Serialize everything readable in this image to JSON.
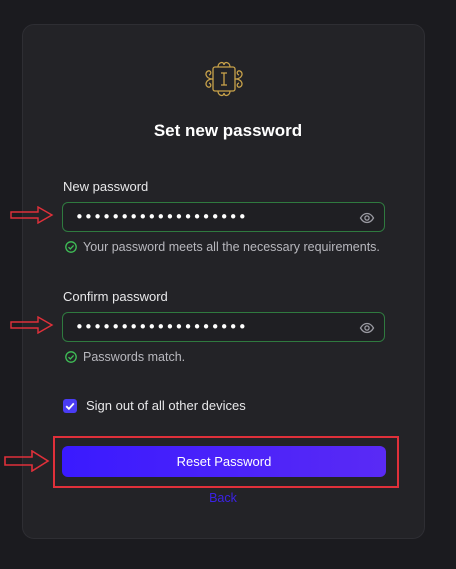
{
  "form": {
    "title": "Set new password",
    "new_password": {
      "label": "New password",
      "value_masked": "•••••••••••••••••••",
      "hint": "Your password meets all the necessary requirements."
    },
    "confirm_password": {
      "label": "Confirm password",
      "value_masked": "•••••••••••••••••••",
      "hint": "Passwords match."
    },
    "sign_out_checkbox": {
      "label": "Sign out of all other devices",
      "checked": true
    },
    "submit_label": "Reset Password",
    "back_label": "Back"
  },
  "colors": {
    "background": "#1b1b1f",
    "card": "#232327",
    "input_border_valid": "#2f7a3f",
    "success_icon": "#3fbf57",
    "primary_button": "#3a1aff",
    "link": "#3b22e6",
    "annotation_red": "#e0303a",
    "logo_gold": "#c8a24a"
  },
  "icons": {
    "logo": "ornamental-monogram-logo",
    "eye": "eye-icon",
    "check": "check-circle-icon",
    "checkbox": "checkmark-icon",
    "annotation_arrow": "right-arrow-icon"
  }
}
